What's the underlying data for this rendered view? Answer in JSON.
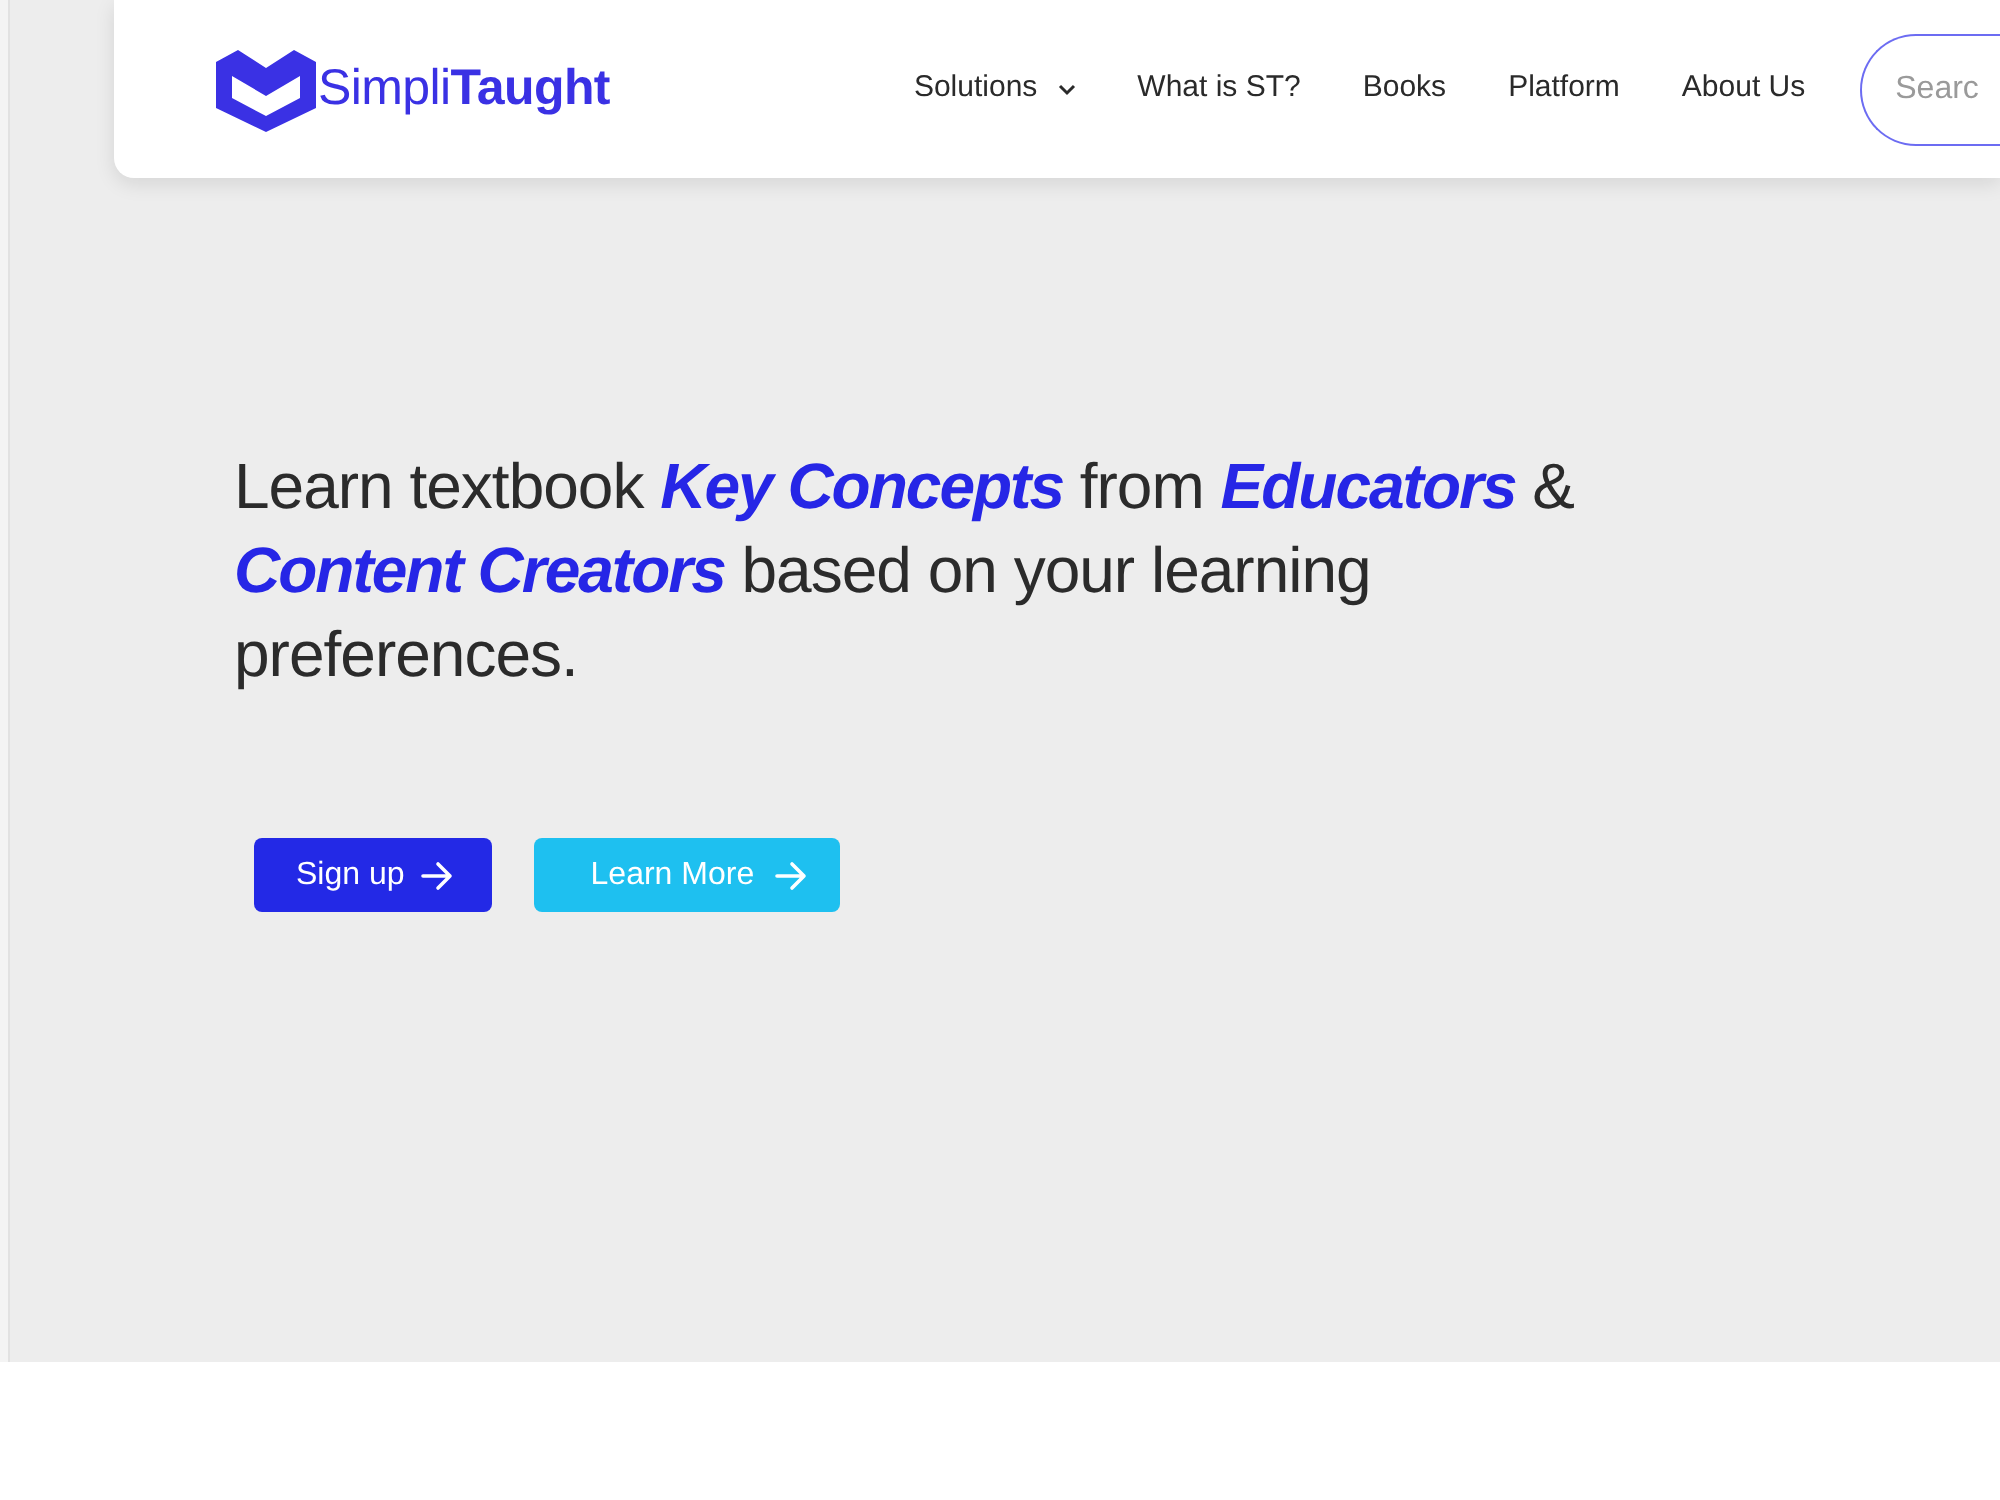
{
  "header": {
    "logo": {
      "text": "Simpli**Taught**"
    },
    "nav": [
      {
        "label": "Solutions",
        "has_dropdown": true
      },
      {
        "label": "What is ST?",
        "has_dropdown": false
      },
      {
        "label": "Books",
        "has_dropdown": false
      },
      {
        "label": "Platform",
        "has_dropdown": false
      },
      {
        "label": "About Us",
        "has_dropdown": false
      }
    ],
    "search": {
      "placeholder": "Searc"
    }
  },
  "hero": {
    "headline": "Learn textbook **Key Concepts** from **Educators** & **Content Creators** based on your learning preferences.",
    "buttons": [
      {
        "label": "Sign up",
        "kind": "primary"
      },
      {
        "label": "Learn More",
        "kind": "secondary"
      }
    ]
  }
}
